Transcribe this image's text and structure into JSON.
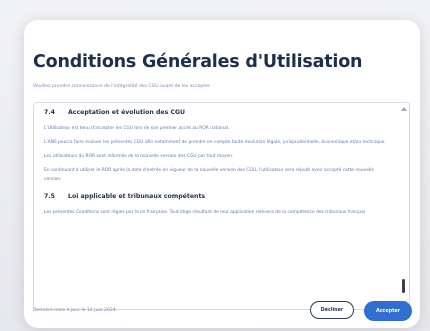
{
  "modal": {
    "title": "Conditions Générales d'Utilisation",
    "subtitle": "Veuillez prendre connaissance de l'intégralité des CGU avant de les accepter.",
    "sections": [
      {
        "number": "7.4",
        "heading": "Acceptation et évolution des CGU",
        "paragraphs": [
          "L'Utilisateur est tenu d'accepter les CGU lors de son premier accès au ROR national.",
          "L'ANS pourra faire évoluer les présentes CGU afin notamment de prendre en compte toute évolution légale, jurisprudentielle, économique et/ou technique.",
          "Les utilisateurs du ROR sont informés de la nouvelle version des CGU par tout moyen.",
          "En continuant à utiliser le ROR après la date d'entrée en vigueur de la nouvelle version des CGU, l'utilisateur sera réputé avoir accepté cette nouvelle version."
        ]
      },
      {
        "number": "7.5",
        "heading": "Loi applicable et tribunaux compétents",
        "paragraphs": [
          "Les présentes Conditions sont régies par la loi française. Tout litige résultant de leur application relèvera de la compétence des tribunaux français."
        ]
      }
    ],
    "footer_note": "Dernière mise à jour le 14 juin 2024.",
    "decline_label": "Décliner",
    "accept_label": "Accepter"
  }
}
